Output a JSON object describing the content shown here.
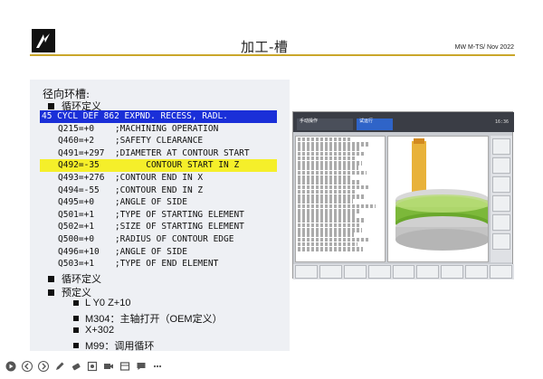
{
  "header": {
    "title": "加工-槽",
    "date": "MW M-TS/ Nov 2022"
  },
  "slide": {
    "heading": "径向环槽:",
    "bullet_cycle_def": "循环定义",
    "bullet_cycle_def_2": "循环定义",
    "bullet_predef": "预定义",
    "predef_items": [
      "L Y0 Z+10",
      "M304：主轴打开（OEM定义）",
      "X+302",
      "M99：调用循环"
    ]
  },
  "code": {
    "lines": [
      "45 CYCL DEF 862 EXPND. RECESS, RADL.",
      "Q215=+0    ;MACHINING OPERATION",
      "Q460=+2    ;SAFETY CLEARANCE",
      "Q491=+297  ;DIAMETER AT CONTOUR START",
      "Q492=-35         CONTOUR START IN Z",
      "Q493=+276  ;CONTOUR END IN X",
      "Q494=-55   ;CONTOUR END IN Z",
      "Q495=+0    ;ANGLE OF SIDE",
      "Q501=+1    ;TYPE OF STARTING ELEMENT",
      "Q502=+1    ;SIZE OF STARTING ELEMENT",
      "Q500=+0    ;RADIUS OF CONTOUR EDGE",
      "Q496=+10   ;ANGLE OF SIDE",
      "Q503=+1    ;TYPE OF END ELEMENT"
    ]
  },
  "cnc": {
    "tab1": "手动操作",
    "tab2": "试运行",
    "num": "16:36",
    "softkeys": [
      "",
      "",
      "",
      "",
      "",
      "",
      "",
      "",
      ""
    ]
  },
  "colors": {
    "header_line": "#caa72a",
    "code_header_bg": "#1a2fd8",
    "highlight": "#f5ef2a"
  },
  "toolbar": {
    "icons": [
      "play-icon",
      "prev-icon",
      "next-icon",
      "pen-icon",
      "eraser-icon",
      "zoom-icon",
      "video-icon",
      "layout-icon",
      "chat-icon",
      "more-icon"
    ]
  }
}
